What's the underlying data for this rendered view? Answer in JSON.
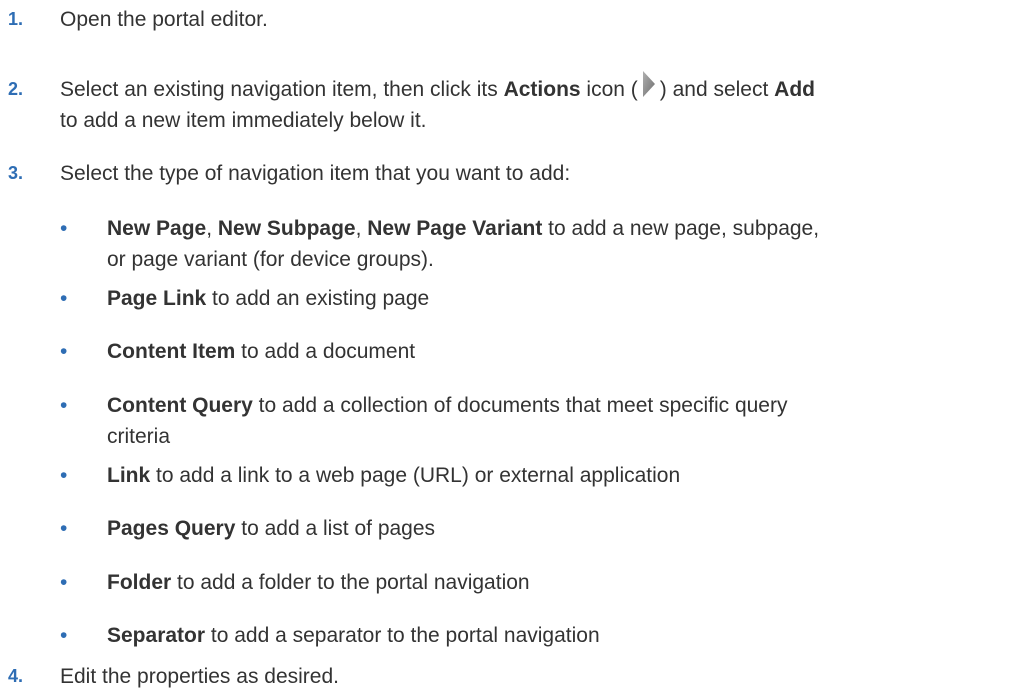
{
  "steps": [
    {
      "num": "1.",
      "text": "Open the portal editor."
    },
    {
      "num": "2.",
      "a": "Select an existing navigation item, then click its ",
      "b": "Actions",
      "c": " icon (",
      "icon": "actions-arrow-icon",
      "d": ") and select ",
      "e": "Add",
      "f": "to add a new item immediately below it."
    },
    {
      "num": "3.",
      "text": "Select the type of navigation item that you want to add:"
    },
    {
      "num": "4.",
      "text": "Edit the properties as desired."
    }
  ],
  "bullet_char": "•",
  "items": [
    {
      "b1": "New Page",
      "s1": ", ",
      "b2": "New Subpage",
      "s2": ", ",
      "b3": "New Page Variant",
      "rest": " to add a new page, subpage,",
      "rest2": "or page variant (for device groups)."
    },
    {
      "bold": "Page Link",
      "rest": " to add an existing page"
    },
    {
      "bold": "Content Item",
      "rest": " to add a document"
    },
    {
      "bold": "Content Query",
      "rest": " to add a collection of documents that meet specific query",
      "rest2": "criteria"
    },
    {
      "bold": "Link",
      "rest": " to add a link to a web page (URL) or external application"
    },
    {
      "bold": "Pages Query",
      "rest": " to add a list of pages"
    },
    {
      "bold": "Folder",
      "rest": " to add a folder to the portal navigation"
    },
    {
      "bold": "Separator",
      "rest": " to add a separator to the portal navigation"
    }
  ],
  "colors": {
    "number": "#2e6db4",
    "text": "#333333",
    "icon": "#8a8a8a"
  }
}
